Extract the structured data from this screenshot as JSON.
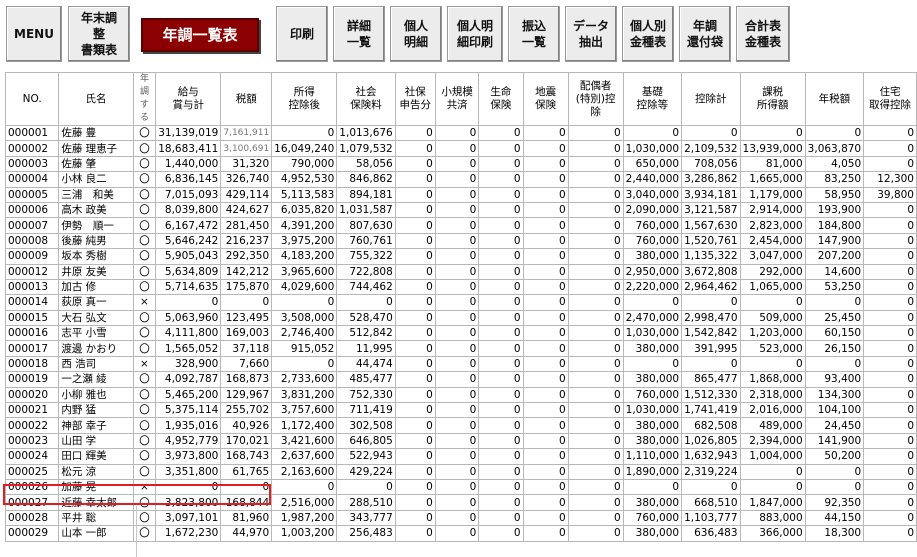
{
  "toolbar": {
    "menu": "MENU",
    "year_end_docs": "年末調\n整\n書類表",
    "list": "年調一覧表",
    "print": "印刷",
    "detail_list": "詳細\n一覧",
    "personal_detail": "個人\n明細",
    "personal_detail_print": "個人明\n細印刷",
    "transfer_list": "振込\n一覧",
    "data_extract": "データ\n抽出",
    "personal_amount": "個人別\n金種表",
    "refund_envelope": "年調\n還付袋",
    "total_amount": "合計表\n金種表"
  },
  "columns": [
    "NO.",
    "氏名",
    "年調\nする",
    "給与\n賞与計",
    "税額",
    "所得\n控除後",
    "社会\n保険料",
    "社保\n申告分",
    "小規模\n共済",
    "生命\n保険",
    "地震\n保険",
    "配偶者\n(特別)控除",
    "基礎\n控除等",
    "控除計",
    "課税\n所得額",
    "年税額",
    "住宅\n取得控除"
  ],
  "rows": [
    [
      "000001",
      "佐藤 豊",
      "〇",
      "31,139,019",
      "7,161,911",
      "0",
      "1,013,676",
      "0",
      "0",
      "0",
      "0",
      "0",
      "0",
      "0",
      "0",
      "0",
      "0"
    ],
    [
      "000002",
      "佐藤 理恵子",
      "〇",
      "18,683,411",
      "3,100,691",
      "16,049,240",
      "1,079,532",
      "0",
      "0",
      "0",
      "0",
      "0",
      "1,030,000",
      "2,109,532",
      "13,939,000",
      "3,063,870",
      "0"
    ],
    [
      "000003",
      "佐藤 肇",
      "〇",
      "1,440,000",
      "31,320",
      "790,000",
      "58,056",
      "0",
      "0",
      "0",
      "0",
      "0",
      "650,000",
      "708,056",
      "81,000",
      "4,050",
      "0"
    ],
    [
      "000004",
      "小林 良二",
      "〇",
      "6,836,145",
      "326,740",
      "4,952,530",
      "846,862",
      "0",
      "0",
      "0",
      "0",
      "0",
      "2,440,000",
      "3,286,862",
      "1,665,000",
      "83,250",
      "12,300"
    ],
    [
      "000005",
      "三浦　和美",
      "〇",
      "7,015,093",
      "429,114",
      "5,113,583",
      "894,181",
      "0",
      "0",
      "0",
      "0",
      "0",
      "3,040,000",
      "3,934,181",
      "1,179,000",
      "58,950",
      "39,800"
    ],
    [
      "000006",
      "高木 政美",
      "〇",
      "8,039,800",
      "424,627",
      "6,035,820",
      "1,031,587",
      "0",
      "0",
      "0",
      "0",
      "0",
      "2,090,000",
      "3,121,587",
      "2,914,000",
      "193,900",
      "0"
    ],
    [
      "000007",
      "伊勢　順一",
      "〇",
      "6,167,472",
      "281,450",
      "4,391,200",
      "807,630",
      "0",
      "0",
      "0",
      "0",
      "0",
      "760,000",
      "1,567,630",
      "2,823,000",
      "184,800",
      "0"
    ],
    [
      "000008",
      "後藤 純男",
      "〇",
      "5,646,242",
      "216,237",
      "3,975,200",
      "760,761",
      "0",
      "0",
      "0",
      "0",
      "0",
      "760,000",
      "1,520,761",
      "2,454,000",
      "147,900",
      "0"
    ],
    [
      "000009",
      "坂本 秀樹",
      "〇",
      "5,905,043",
      "292,350",
      "4,183,200",
      "755,322",
      "0",
      "0",
      "0",
      "0",
      "0",
      "380,000",
      "1,135,322",
      "3,047,000",
      "207,200",
      "0"
    ],
    [
      "000012",
      "井原 友美",
      "〇",
      "5,634,809",
      "142,212",
      "3,965,600",
      "722,808",
      "0",
      "0",
      "0",
      "0",
      "0",
      "2,950,000",
      "3,672,808",
      "292,000",
      "14,600",
      "0"
    ],
    [
      "000013",
      "加古 修",
      "〇",
      "5,714,635",
      "175,870",
      "4,029,600",
      "744,462",
      "0",
      "0",
      "0",
      "0",
      "0",
      "2,220,000",
      "2,964,462",
      "1,065,000",
      "53,250",
      "0"
    ],
    [
      "000014",
      "荻原 真一",
      "×",
      "0",
      "0",
      "0",
      "0",
      "0",
      "0",
      "0",
      "0",
      "0",
      "0",
      "0",
      "0",
      "0",
      "0"
    ],
    [
      "000015",
      "大石 弘文",
      "〇",
      "5,063,960",
      "123,495",
      "3,508,000",
      "528,470",
      "0",
      "0",
      "0",
      "0",
      "0",
      "2,470,000",
      "2,998,470",
      "509,000",
      "25,450",
      "0"
    ],
    [
      "000016",
      "志平 小雪",
      "〇",
      "4,111,800",
      "169,003",
      "2,746,400",
      "512,842",
      "0",
      "0",
      "0",
      "0",
      "0",
      "1,030,000",
      "1,542,842",
      "1,203,000",
      "60,150",
      "0"
    ],
    [
      "000017",
      "渡邊 かおり",
      "〇",
      "1,565,052",
      "37,118",
      "915,052",
      "11,995",
      "0",
      "0",
      "0",
      "0",
      "0",
      "380,000",
      "391,995",
      "523,000",
      "26,150",
      "0"
    ],
    [
      "000018",
      "西 浩司",
      "×",
      "328,900",
      "7,660",
      "0",
      "44,474",
      "0",
      "0",
      "0",
      "0",
      "0",
      "0",
      "0",
      "0",
      "0",
      "0"
    ],
    [
      "000019",
      "一之瀬 綾",
      "〇",
      "4,092,787",
      "168,873",
      "2,733,600",
      "485,477",
      "0",
      "0",
      "0",
      "0",
      "0",
      "380,000",
      "865,477",
      "1,868,000",
      "93,400",
      "0"
    ],
    [
      "000020",
      "小柳 雅也",
      "〇",
      "5,465,200",
      "129,967",
      "3,831,200",
      "752,330",
      "0",
      "0",
      "0",
      "0",
      "0",
      "760,000",
      "1,512,330",
      "2,318,000",
      "134,300",
      "0"
    ],
    [
      "000021",
      "内野 猛",
      "〇",
      "5,375,114",
      "255,702",
      "3,757,600",
      "711,419",
      "0",
      "0",
      "0",
      "0",
      "0",
      "1,030,000",
      "1,741,419",
      "2,016,000",
      "104,100",
      "0"
    ],
    [
      "000022",
      "神部 幸子",
      "〇",
      "1,935,016",
      "40,926",
      "1,172,400",
      "302,508",
      "0",
      "0",
      "0",
      "0",
      "0",
      "380,000",
      "682,508",
      "489,000",
      "24,450",
      "0"
    ],
    [
      "000023",
      "山田 学",
      "〇",
      "4,952,779",
      "170,021",
      "3,421,600",
      "646,805",
      "0",
      "0",
      "0",
      "0",
      "0",
      "380,000",
      "1,026,805",
      "2,394,000",
      "141,900",
      "0"
    ],
    [
      "000024",
      "田口 輝美",
      "〇",
      "3,973,800",
      "168,743",
      "2,637,600",
      "522,943",
      "0",
      "0",
      "0",
      "0",
      "0",
      "1,110,000",
      "1,632,943",
      "1,004,000",
      "50,200",
      "0"
    ],
    [
      "000025",
      "松元 涼",
      "〇",
      "3,351,800",
      "61,765",
      "2,163,600",
      "429,224",
      "0",
      "0",
      "0",
      "0",
      "0",
      "1,890,000",
      "2,319,224",
      "0",
      "0",
      "0"
    ],
    [
      "000026",
      "加藤 晃",
      "×",
      "0",
      "0",
      "0",
      "0",
      "0",
      "0",
      "0",
      "0",
      "0",
      "0",
      "0",
      "0",
      "0",
      "0"
    ],
    [
      "000027",
      "近藤 幸太郎",
      "〇",
      "3,823,800",
      "168,844",
      "2,516,000",
      "288,510",
      "0",
      "0",
      "0",
      "0",
      "0",
      "380,000",
      "668,510",
      "1,847,000",
      "92,350",
      "0"
    ],
    [
      "000028",
      "平井 聡",
      "〇",
      "3,097,101",
      "81,960",
      "1,987,200",
      "343,777",
      "0",
      "0",
      "0",
      "0",
      "0",
      "760,000",
      "1,103,777",
      "883,000",
      "44,150",
      "0"
    ],
    [
      "000029",
      "山本 一郎",
      "〇",
      "1,672,230",
      "44,970",
      "1,003,200",
      "256,483",
      "0",
      "0",
      "0",
      "0",
      "0",
      "380,000",
      "636,483",
      "366,000",
      "18,300",
      "0"
    ]
  ]
}
